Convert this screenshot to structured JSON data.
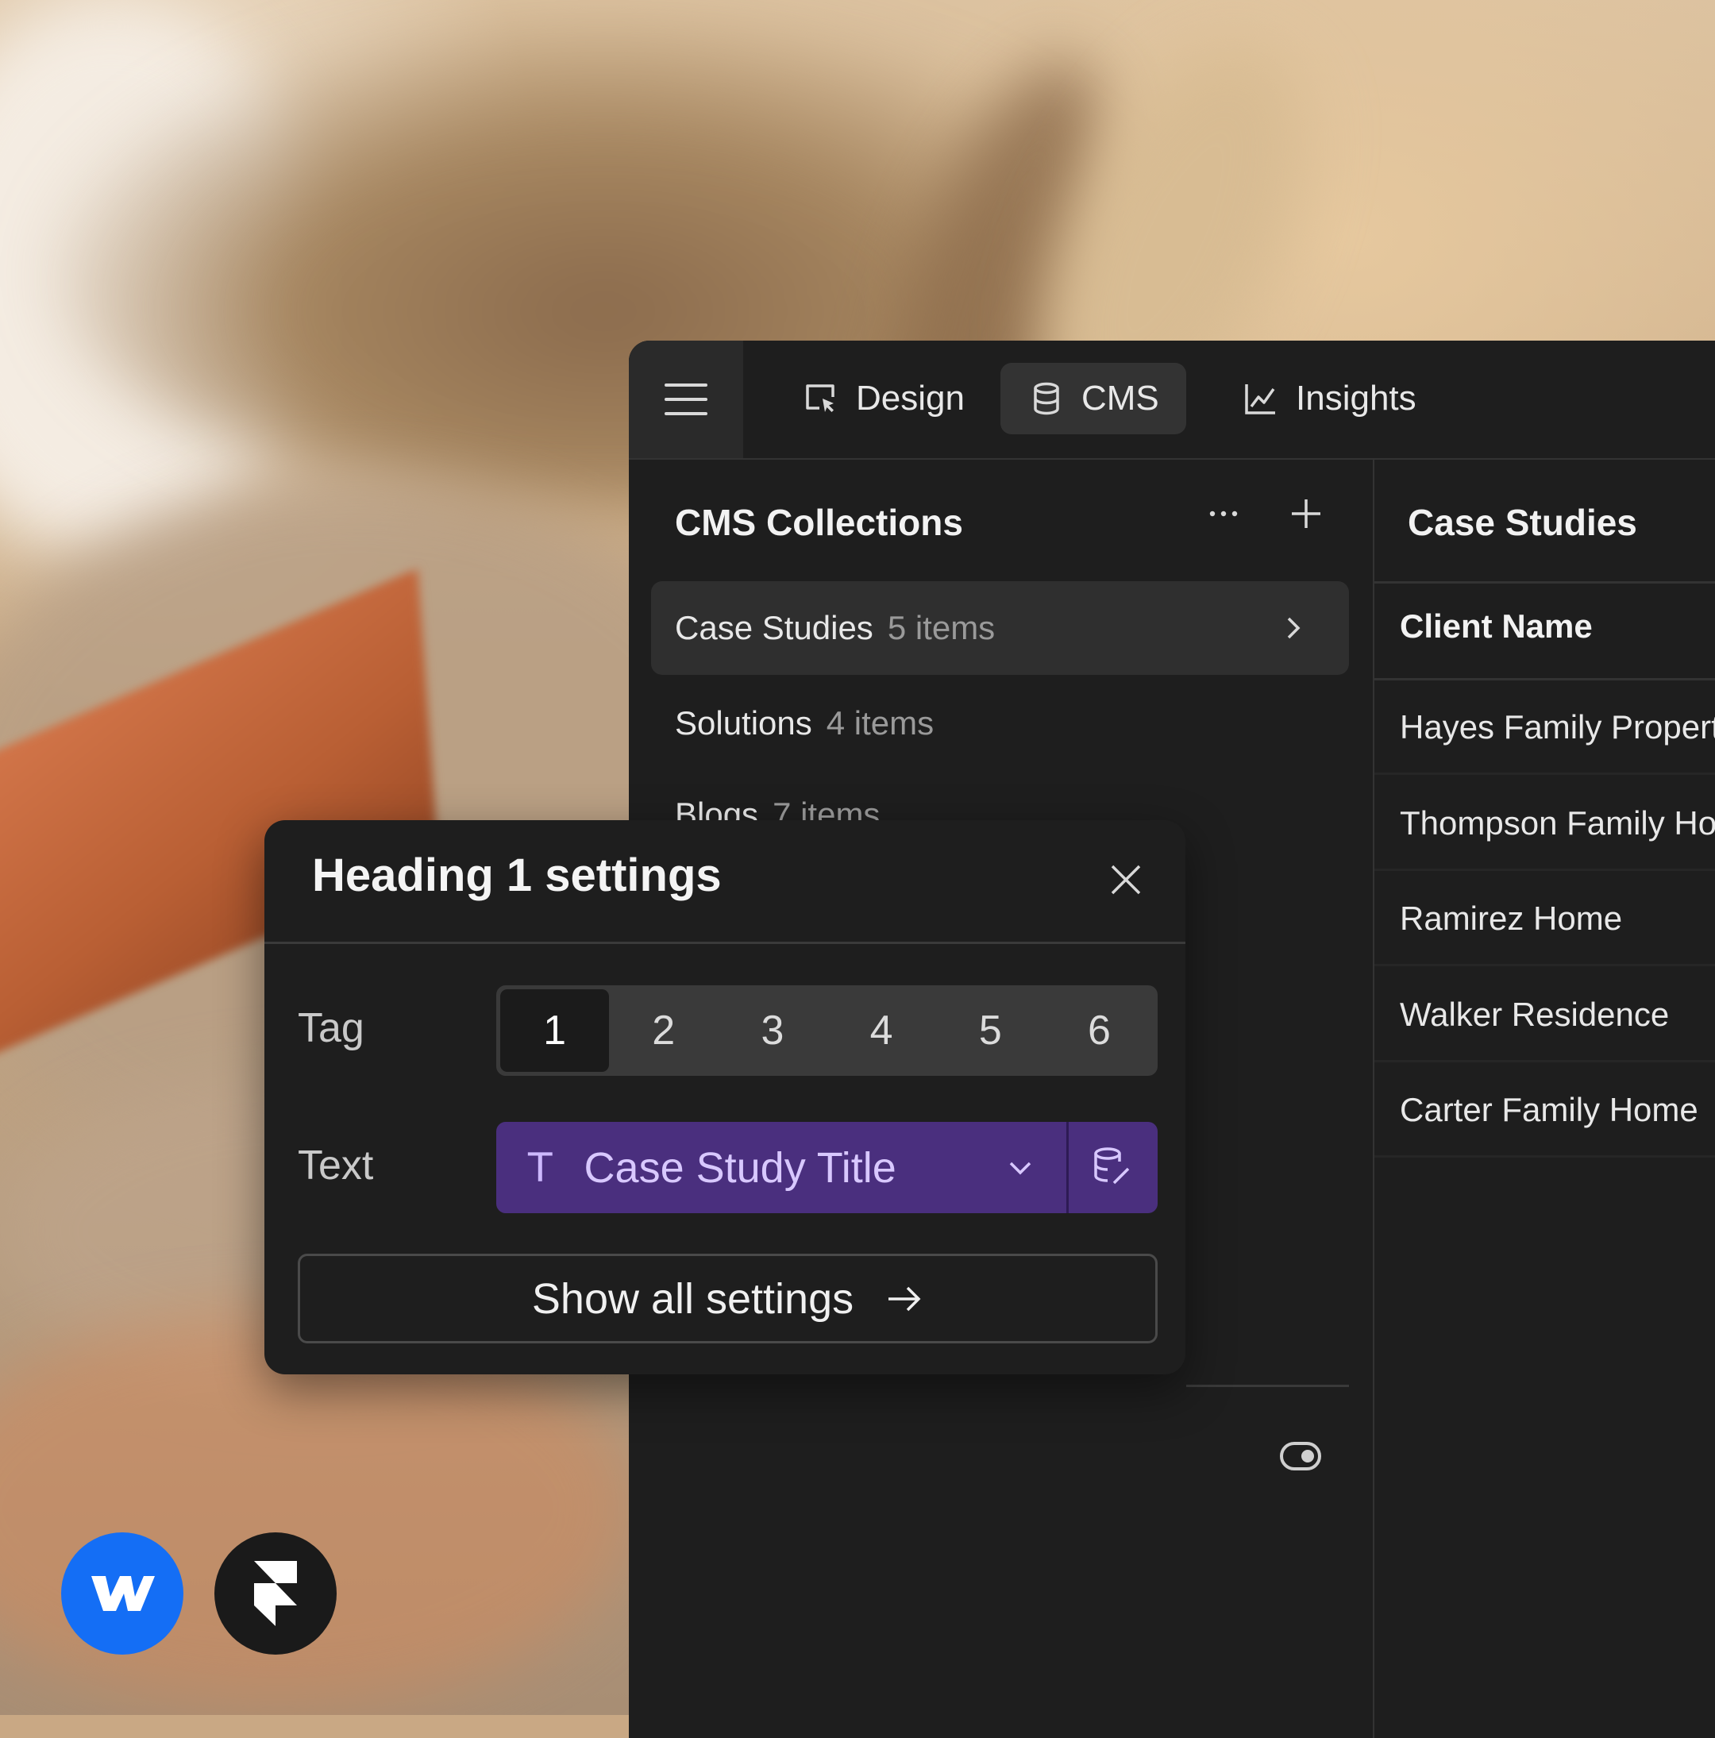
{
  "topbar": {
    "tabs": [
      {
        "label": "Design",
        "icon": "cursor-select-icon"
      },
      {
        "label": "CMS",
        "icon": "database-icon",
        "active": true
      },
      {
        "label": "Insights",
        "icon": "line-chart-icon"
      }
    ]
  },
  "collections": {
    "title": "CMS Collections",
    "items": [
      {
        "name": "Case Studies",
        "count": "5 items",
        "active": true
      },
      {
        "name": "Solutions",
        "count": "4 items"
      },
      {
        "name": "Blogs",
        "count": "7 items"
      }
    ]
  },
  "case_studies": {
    "title": "Case Studies",
    "column_header": "Client Name",
    "rows": [
      "Hayes Family Properties",
      "Thompson Family Home",
      "Ramirez Home",
      "Walker Residence",
      "Carter Family Home"
    ]
  },
  "settings_popover": {
    "title": "Heading 1 settings",
    "tag_label": "Tag",
    "tag_options": [
      "1",
      "2",
      "3",
      "4",
      "5",
      "6"
    ],
    "tag_selected": "1",
    "text_label": "Text",
    "text_binding": "Case Study Title",
    "text_type_glyph": "T",
    "show_all_label": "Show all settings"
  },
  "colors": {
    "panel_bg": "#1e1e1e",
    "binding_purple": "#4a2f7e",
    "webflow_blue": "#146ef5"
  },
  "logos": [
    "webflow-logo",
    "framer-logo"
  ]
}
